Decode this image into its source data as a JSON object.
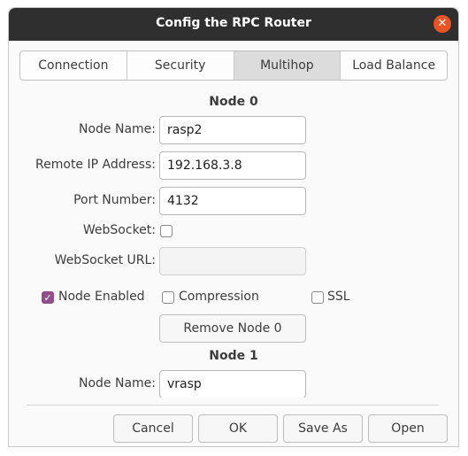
{
  "window": {
    "title": "Config the RPC Router",
    "close_symbol": "✕"
  },
  "tabs": [
    {
      "label": "Connection",
      "active": false
    },
    {
      "label": "Security",
      "active": false
    },
    {
      "label": "Multihop",
      "active": true
    },
    {
      "label": "Load Balance",
      "active": false
    }
  ],
  "node0": {
    "header": "Node 0",
    "node_name_label": "Node Name:",
    "node_name_value": "rasp2",
    "remote_ip_label": "Remote IP Address:",
    "remote_ip_value": "192.168.3.8",
    "port_label": "Port Number:",
    "port_value": "4132",
    "websocket_label": "WebSocket:",
    "websocket_checked": false,
    "websocket_url_label": "WebSocket URL:",
    "websocket_url_value": "",
    "node_enabled_label": "Node Enabled",
    "node_enabled_checked": true,
    "compression_label": "Compression",
    "compression_checked": false,
    "ssl_label": "SSL",
    "ssl_checked": false,
    "remove_label": "Remove Node 0"
  },
  "node1": {
    "header": "Node 1",
    "node_name_label": "Node Name:",
    "node_name_value": "vrasp"
  },
  "buttons": {
    "cancel": "Cancel",
    "ok": "OK",
    "save_as": "Save As",
    "open": "Open"
  },
  "colors": {
    "titlebar": "#2f2f2f",
    "close": "#e95420",
    "checkbox_checked": "#924d8b"
  }
}
